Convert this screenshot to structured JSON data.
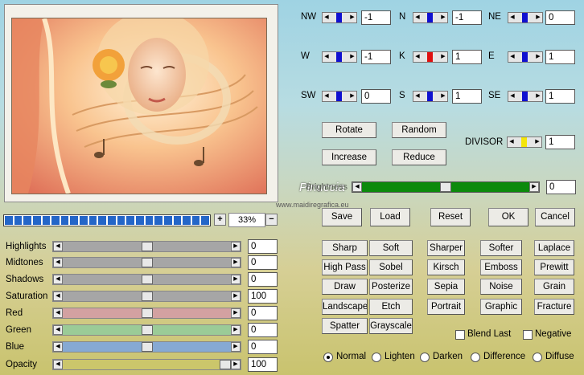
{
  "zoom": {
    "value": "33%",
    "plus": "+",
    "minus": "−"
  },
  "progress": {
    "fraction": 1.0,
    "segments": 22
  },
  "adjust": [
    {
      "label": "Highlights",
      "value": "0",
      "fill": "#a6a6a6",
      "thumb": 0.5
    },
    {
      "label": "Midtones",
      "value": "0",
      "fill": "#a6a6a6",
      "thumb": 0.5
    },
    {
      "label": "Shadows",
      "value": "0",
      "fill": "#a6a6a6",
      "thumb": 0.5
    },
    {
      "label": "Saturation",
      "value": "100",
      "fill": "#a6a6a6",
      "thumb": 0.5
    },
    {
      "label": "Red",
      "value": "0",
      "fill": "#d3a1a1",
      "thumb": 0.5
    },
    {
      "label": "Green",
      "value": "0",
      "fill": "#9bcb97",
      "thumb": 0.5
    },
    {
      "label": "Blue",
      "value": "0",
      "fill": "#86a9d3",
      "thumb": 0.5
    },
    {
      "label": "Opacity",
      "value": "100",
      "fill": "#cbc66b",
      "thumb": 1.0
    }
  ],
  "matrix": [
    {
      "label": "NW",
      "value": "-1",
      "color": "#1010d0"
    },
    {
      "label": "N",
      "value": "-1",
      "color": "#1010d0"
    },
    {
      "label": "NE",
      "value": "0",
      "color": "#1010d0"
    },
    {
      "label": "W",
      "value": "-1",
      "color": "#1010d0"
    },
    {
      "label": "K",
      "value": "1",
      "color": "#e01010"
    },
    {
      "label": "E",
      "value": "1",
      "color": "#1010d0"
    },
    {
      "label": "SW",
      "value": "0",
      "color": "#1010d0"
    },
    {
      "label": "S",
      "value": "1",
      "color": "#1010d0"
    },
    {
      "label": "SE",
      "value": "1",
      "color": "#1010d0"
    }
  ],
  "ops": {
    "rotate": "Rotate",
    "random": "Random",
    "increase": "Increase",
    "reduce": "Reduce"
  },
  "divisor": {
    "label": "DIVISOR",
    "value": "1",
    "color": "#f5e60a"
  },
  "brightness": {
    "label": "Brightness",
    "value": "0",
    "thumb": 0.5
  },
  "actions": {
    "save": "Save",
    "load": "Load",
    "reset": "Reset",
    "ok": "OK",
    "cancel": "Cancel"
  },
  "presets": [
    [
      "Sharp",
      "Soft",
      "Sharper",
      "Softer",
      "Laplace"
    ],
    [
      "High Pass",
      "Sobel",
      "Kirsch",
      "Emboss",
      "Prewitt"
    ],
    [
      "Draw",
      "Posterize",
      "Sepia",
      "Noise",
      "Grain"
    ],
    [
      "Landscape",
      "Etch",
      "Portrait",
      "Graphic",
      "Fracture"
    ],
    [
      "Spatter",
      "Grayscale"
    ]
  ],
  "options": {
    "blend_last": "Blend Last",
    "negative": "Negative"
  },
  "blend_modes": [
    "Normal",
    "Lighten",
    "Darken",
    "Difference",
    "Diffuse"
  ],
  "selected_mode": "Normal",
  "watermark": {
    "name": "Pinuccia",
    "site": "www.maidiregrafica.eu"
  }
}
